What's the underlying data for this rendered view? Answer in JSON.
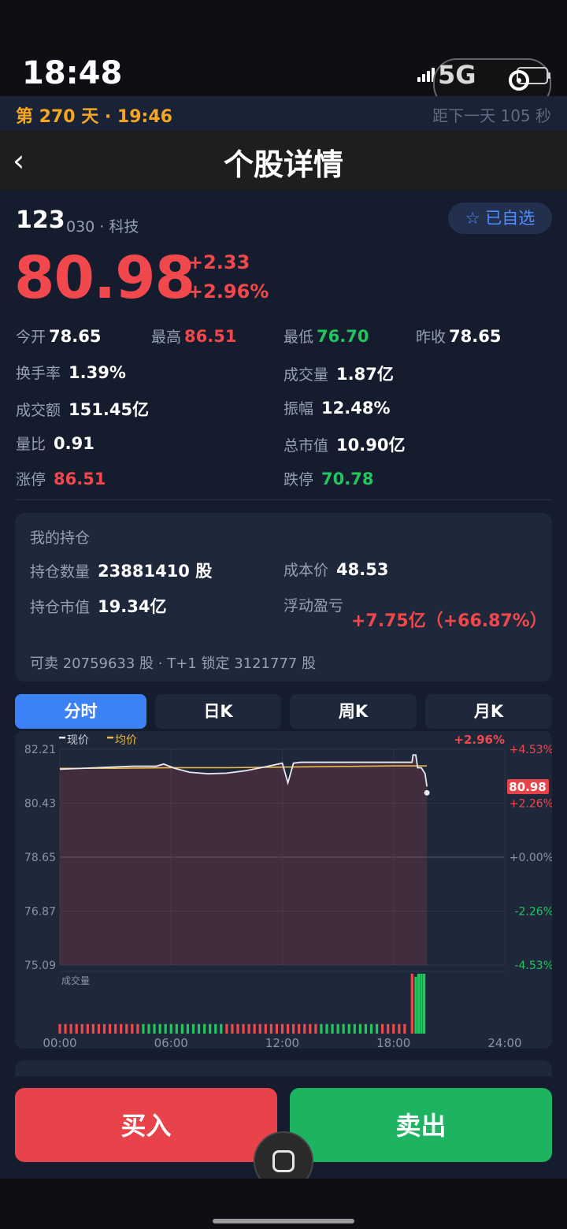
{
  "status_bar": {
    "time": "18:48",
    "network": "5G"
  },
  "game": {
    "day_label": "第 270 天 · 19:46",
    "countdown": "距下一天 105 秒"
  },
  "header": {
    "back": "‹",
    "title": "个股详情"
  },
  "stock": {
    "name": "123",
    "meta": "030 · 科技",
    "watch_label": "☆ 已自选",
    "price": "80.98",
    "change_abs": "+2.33",
    "change_pct": "+2.96%"
  },
  "stats": [
    {
      "label": "今开",
      "value": "78.65",
      "tone": "white"
    },
    {
      "label": "最高",
      "value": "86.51",
      "tone": "red"
    },
    {
      "label": "最低",
      "value": "76.70",
      "tone": "green"
    },
    {
      "label": "昨收",
      "value": "78.65",
      "tone": "white"
    },
    {
      "label": "换手率",
      "value": "1.39%",
      "tone": "white"
    },
    {
      "label": "成交量",
      "value": "1.87亿",
      "tone": "white"
    },
    {
      "label": "成交额",
      "value": "151.45亿",
      "tone": "white"
    },
    {
      "label": "振幅",
      "value": "12.48%",
      "tone": "white"
    },
    {
      "label": "量比",
      "value": "0.91",
      "tone": "white"
    },
    {
      "label": "总市值",
      "value": "10.90亿",
      "tone": "white"
    },
    {
      "label": "涨停",
      "value": "86.51",
      "tone": "red"
    },
    {
      "label": "跌停",
      "value": "70.78",
      "tone": "green"
    }
  ],
  "holdings": {
    "title": "我的持仓",
    "qty_label": "持仓数量",
    "qty_value": "23881410 股",
    "cost_label": "成本价",
    "cost_value": "48.53",
    "mv_label": "持仓市值",
    "mv_value": "19.34亿",
    "pnl_label": "浮动盈亏",
    "pnl_value": "+7.75亿（+66.87%）",
    "footer": "可卖 20759633 股 · T+1 锁定 3121777 股"
  },
  "tabs": [
    {
      "label": "分时",
      "active": true
    },
    {
      "label": "日K",
      "active": false
    },
    {
      "label": "周K",
      "active": false
    },
    {
      "label": "月K",
      "active": false
    }
  ],
  "chart_data": {
    "type": "line",
    "legend": [
      "现价",
      "均价"
    ],
    "change_label": "+2.96%",
    "current_price_tag": "80.98",
    "prev_close": 78.65,
    "ylim": [
      75.09,
      82.21
    ],
    "y_ticks_left": [
      "82.21",
      "80.43",
      "78.65",
      "76.87",
      "75.09"
    ],
    "y_ticks_right": [
      "+4.53%",
      "+2.26%",
      "+0.00%",
      "-2.26%",
      "-4.53%"
    ],
    "x_ticks": [
      "00:00",
      "06:00",
      "12:00",
      "18:00",
      "24:00"
    ],
    "x_range_hours": [
      0,
      24
    ],
    "volume_label": "成交量",
    "series": [
      {
        "name": "现价",
        "x": [
          0,
          2,
          4,
          5.2,
          5.6,
          6.2,
          7,
          8,
          9,
          10,
          11,
          12,
          12.3,
          12.6,
          13,
          14,
          15,
          16,
          17,
          18,
          19,
          19.05,
          19.2,
          19.3,
          19.5,
          19.7,
          19.8
        ],
        "values": [
          81.55,
          81.6,
          81.65,
          81.65,
          81.72,
          81.58,
          81.45,
          81.4,
          81.42,
          81.5,
          81.62,
          81.75,
          81.1,
          81.75,
          81.78,
          81.78,
          81.78,
          81.78,
          81.78,
          81.78,
          81.78,
          82.02,
          82.02,
          81.6,
          81.6,
          81.4,
          80.98
        ]
      },
      {
        "name": "均价",
        "x": [
          0,
          3,
          6,
          9,
          12,
          15,
          18,
          19.8
        ],
        "values": [
          81.58,
          81.58,
          81.6,
          81.6,
          81.62,
          81.64,
          81.66,
          81.66
        ]
      }
    ],
    "volume": {
      "red_bars": 16,
      "green_bars": 11,
      "pattern_note_hidden": false,
      "x_step_hours": 0.3,
      "base_level": 0.16,
      "spike_x": [
        19.0,
        19.2,
        19.35,
        19.5,
        19.65
      ],
      "spike_levels": [
        1.0,
        0.95,
        1.0,
        1.0,
        1.0
      ],
      "spike_colors": [
        "red",
        "green",
        "green",
        "green",
        "green"
      ]
    }
  },
  "actions": {
    "buy": "买入",
    "sell": "卖出"
  },
  "colors": {
    "up": "#f0484c",
    "down": "#22c55e",
    "accent": "#3b82f6",
    "gold": "#f5a623"
  }
}
